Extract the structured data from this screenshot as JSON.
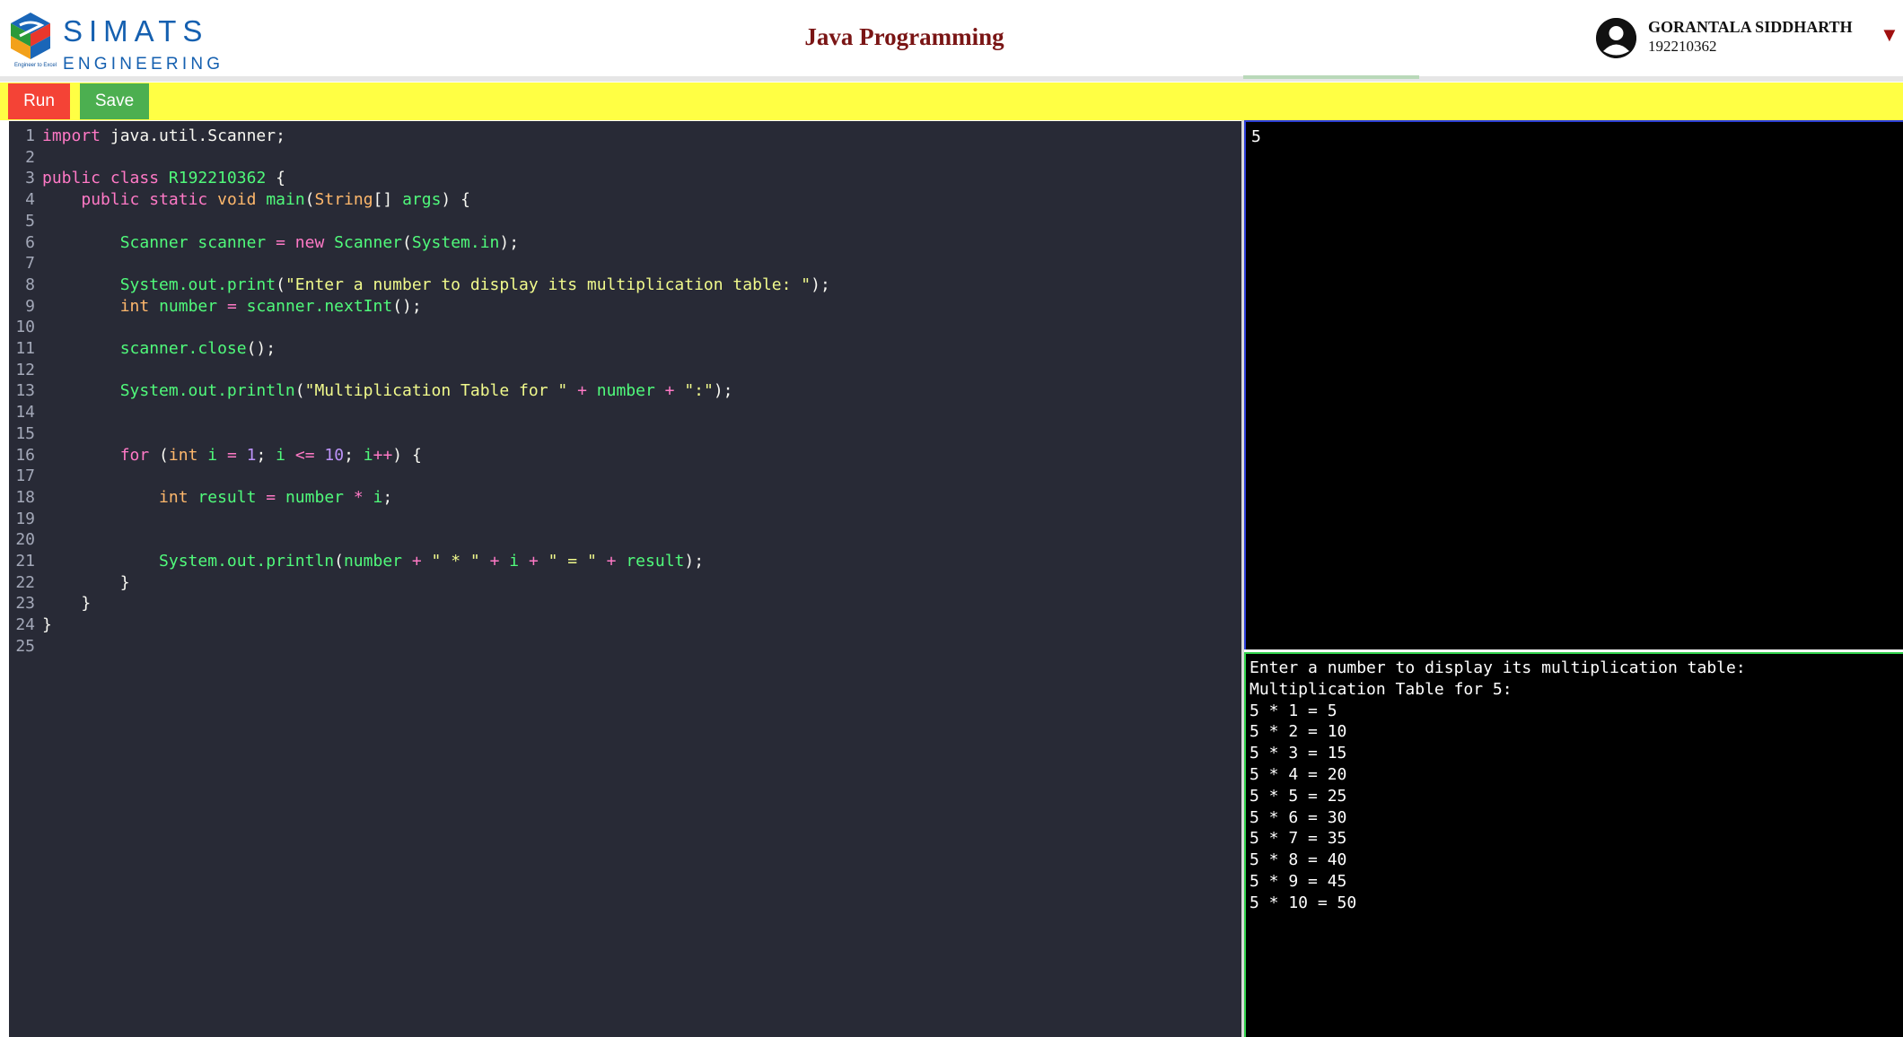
{
  "header": {
    "logo_name": "SIMATS",
    "logo_sub": "ENGINEERING",
    "logo_tagline": "Engineer to Excel",
    "title": "Java Programming",
    "user_name": "GORANTALA SIDDHARTH",
    "user_id": "192210362"
  },
  "toolbar": {
    "run_label": "Run",
    "save_label": "Save"
  },
  "editor": {
    "lines": [
      {
        "n": "1",
        "tokens": [
          [
            "kw",
            "import"
          ],
          [
            "",
            "  java.util.Scanner;"
          ]
        ]
      },
      {
        "n": "2",
        "tokens": []
      },
      {
        "n": "3",
        "tokens": [
          [
            "kw",
            "public"
          ],
          [
            "",
            " "
          ],
          [
            "kw",
            "class"
          ],
          [
            "",
            " "
          ],
          [
            "fn",
            "R192210362"
          ],
          [
            "",
            " {"
          ]
        ]
      },
      {
        "n": "4",
        "tokens": [
          [
            "",
            "    "
          ],
          [
            "kw",
            "public"
          ],
          [
            "",
            " "
          ],
          [
            "kw",
            "static"
          ],
          [
            "",
            " "
          ],
          [
            "ty",
            "void"
          ],
          [
            "",
            " "
          ],
          [
            "fn",
            "main"
          ],
          [
            "",
            "("
          ],
          [
            "ty",
            "String"
          ],
          [
            "",
            "[] "
          ],
          [
            "fn",
            "args"
          ],
          [
            "",
            ") {"
          ]
        ]
      },
      {
        "n": "5",
        "tokens": []
      },
      {
        "n": "6",
        "tokens": [
          [
            "",
            "        "
          ],
          [
            "fn",
            "Scanner"
          ],
          [
            "",
            " "
          ],
          [
            "fn",
            "scanner"
          ],
          [
            "",
            " "
          ],
          [
            "kw",
            "="
          ],
          [
            "",
            " "
          ],
          [
            "kw",
            "new"
          ],
          [
            "",
            " "
          ],
          [
            "fn",
            "Scanner"
          ],
          [
            "",
            "("
          ],
          [
            "fn",
            "System.in"
          ],
          [
            "",
            ");"
          ]
        ]
      },
      {
        "n": "7",
        "tokens": []
      },
      {
        "n": "8",
        "tokens": [
          [
            "",
            "        "
          ],
          [
            "fn",
            "System.out.print"
          ],
          [
            "",
            "("
          ],
          [
            "str",
            "\"Enter a number to display its multiplication table: \""
          ],
          [
            "",
            ");"
          ]
        ]
      },
      {
        "n": "9",
        "tokens": [
          [
            "",
            "        "
          ],
          [
            "ty",
            "int"
          ],
          [
            "",
            " "
          ],
          [
            "fn",
            "number"
          ],
          [
            "",
            " "
          ],
          [
            "kw",
            "="
          ],
          [
            "",
            " "
          ],
          [
            "fn",
            "scanner.nextInt"
          ],
          [
            "",
            "();"
          ]
        ]
      },
      {
        "n": "10",
        "tokens": []
      },
      {
        "n": "11",
        "tokens": [
          [
            "",
            "        "
          ],
          [
            "fn",
            "scanner.close"
          ],
          [
            "",
            "();"
          ]
        ]
      },
      {
        "n": "12",
        "tokens": []
      },
      {
        "n": "13",
        "tokens": [
          [
            "",
            "        "
          ],
          [
            "fn",
            "System.out.println"
          ],
          [
            "",
            "("
          ],
          [
            "str",
            "\"Multiplication Table for \""
          ],
          [
            "",
            " "
          ],
          [
            "kw",
            "+"
          ],
          [
            "",
            " "
          ],
          [
            "fn",
            "number"
          ],
          [
            "",
            " "
          ],
          [
            "kw",
            "+"
          ],
          [
            "",
            " "
          ],
          [
            "str",
            "\":\""
          ],
          [
            "",
            ");"
          ]
        ]
      },
      {
        "n": "14",
        "tokens": []
      },
      {
        "n": "15",
        "tokens": []
      },
      {
        "n": "16",
        "tokens": [
          [
            "",
            "        "
          ],
          [
            "kw",
            "for"
          ],
          [
            "",
            " ("
          ],
          [
            "ty",
            "int"
          ],
          [
            "",
            " "
          ],
          [
            "fn",
            "i"
          ],
          [
            "",
            " "
          ],
          [
            "kw",
            "="
          ],
          [
            "",
            " "
          ],
          [
            "num",
            "1"
          ],
          [
            "",
            "; "
          ],
          [
            "fn",
            "i"
          ],
          [
            "",
            " "
          ],
          [
            "kw",
            "<="
          ],
          [
            "",
            " "
          ],
          [
            "num",
            "10"
          ],
          [
            "",
            "; "
          ],
          [
            "fn",
            "i"
          ],
          [
            "kw",
            "++"
          ],
          [
            "",
            ") {"
          ]
        ]
      },
      {
        "n": "17",
        "tokens": []
      },
      {
        "n": "18",
        "tokens": [
          [
            "",
            "            "
          ],
          [
            "ty",
            "int"
          ],
          [
            "",
            " "
          ],
          [
            "fn",
            "result"
          ],
          [
            "",
            " "
          ],
          [
            "kw",
            "="
          ],
          [
            "",
            " "
          ],
          [
            "fn",
            "number"
          ],
          [
            "",
            " "
          ],
          [
            "kw",
            "*"
          ],
          [
            "",
            " "
          ],
          [
            "fn",
            "i"
          ],
          [
            "",
            ";"
          ]
        ]
      },
      {
        "n": "19",
        "tokens": []
      },
      {
        "n": "20",
        "tokens": []
      },
      {
        "n": "21",
        "tokens": [
          [
            "",
            "            "
          ],
          [
            "fn",
            "System.out.println"
          ],
          [
            "",
            "("
          ],
          [
            "fn",
            "number"
          ],
          [
            "",
            " "
          ],
          [
            "kw",
            "+"
          ],
          [
            "",
            " "
          ],
          [
            "str",
            "\" * \""
          ],
          [
            "",
            " "
          ],
          [
            "kw",
            "+"
          ],
          [
            "",
            " "
          ],
          [
            "fn",
            "i"
          ],
          [
            "",
            " "
          ],
          [
            "kw",
            "+"
          ],
          [
            "",
            " "
          ],
          [
            "str",
            "\" = \""
          ],
          [
            "",
            " "
          ],
          [
            "kw",
            "+"
          ],
          [
            "",
            " "
          ],
          [
            "fn",
            "result"
          ],
          [
            "",
            ");"
          ]
        ]
      },
      {
        "n": "22",
        "tokens": [
          [
            "",
            "        }"
          ]
        ]
      },
      {
        "n": "23",
        "tokens": [
          [
            "",
            "    }"
          ]
        ]
      },
      {
        "n": "24",
        "tokens": [
          [
            "",
            "}"
          ]
        ]
      },
      {
        "n": "25",
        "tokens": []
      }
    ]
  },
  "stdin": {
    "value": "5"
  },
  "stdout": {
    "lines": [
      "Enter a number to display its multiplication table:",
      "Multiplication Table for 5:",
      "5 * 1 = 5",
      "5 * 2 = 10",
      "5 * 3 = 15",
      "5 * 4 = 20",
      "5 * 5 = 25",
      "5 * 6 = 30",
      "5 * 7 = 35",
      "5 * 8 = 40",
      "5 * 9 = 45",
      "5 * 10 = 50"
    ]
  },
  "colors": {
    "run": "#f44336",
    "save": "#4caf50",
    "toolbar": "#ffff44",
    "editor_bg": "#282a36",
    "title": "#7a1515"
  },
  "icons": {
    "user": "user-avatar-icon",
    "dropdown": "caret-down-icon",
    "logo": "simats-logo-mark"
  }
}
